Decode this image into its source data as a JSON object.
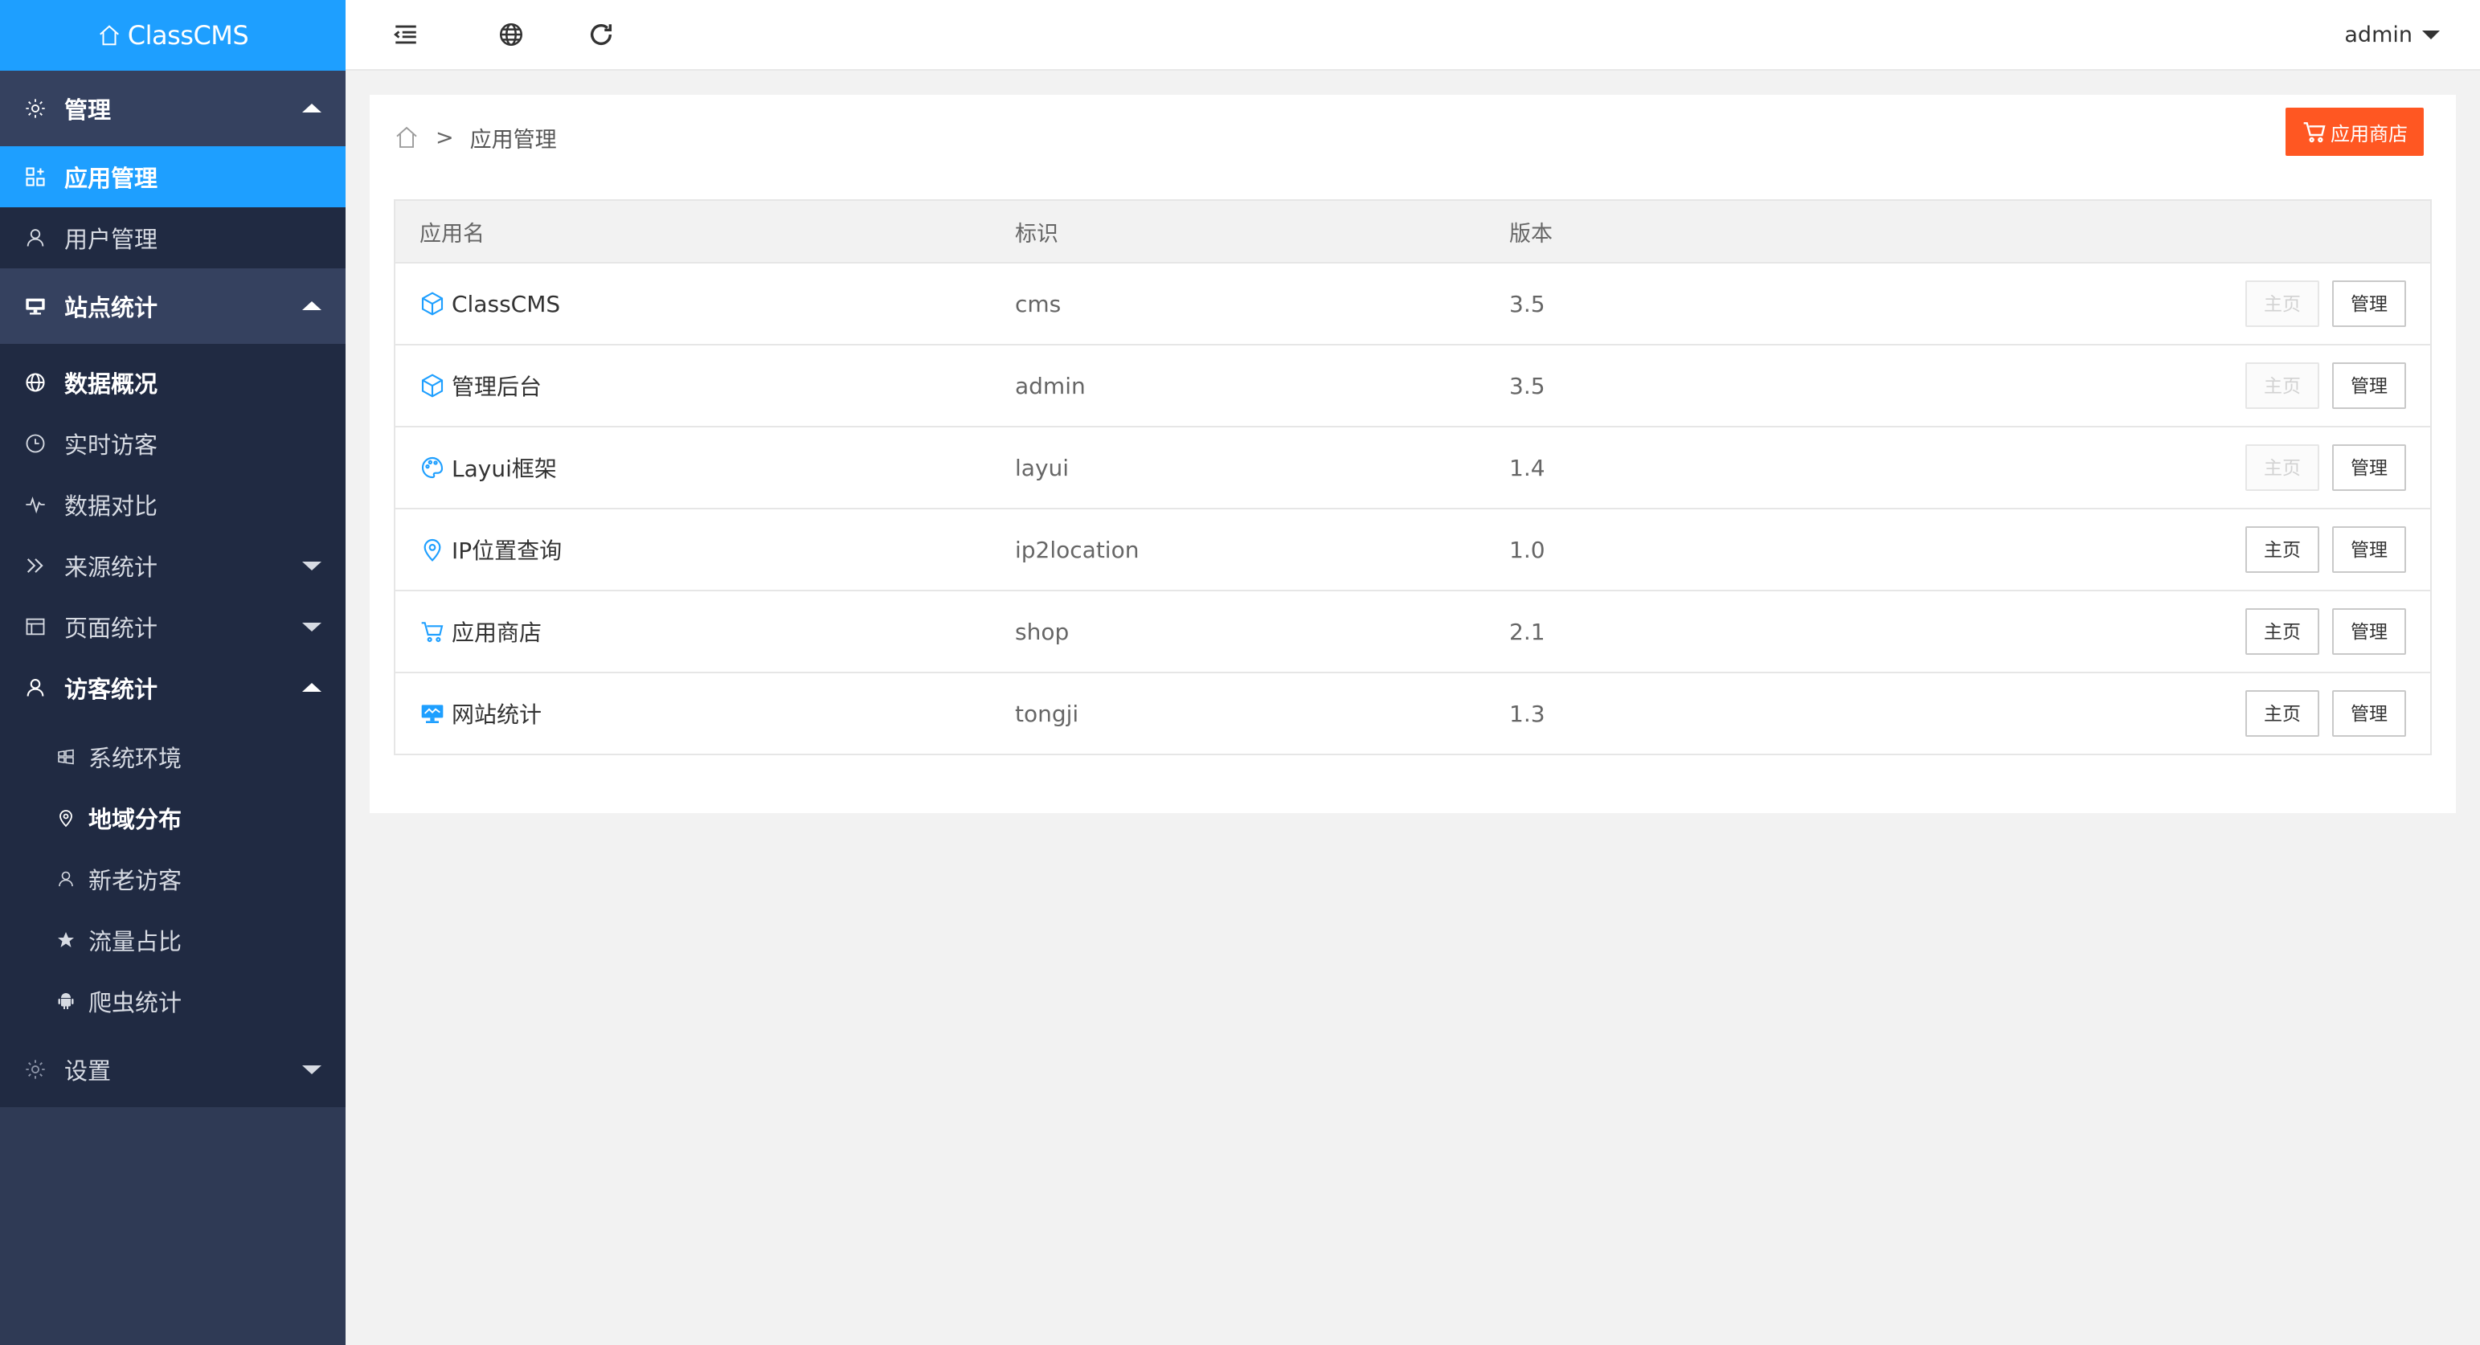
{
  "app": {
    "logo_text": "ClassCMS"
  },
  "sidebar": {
    "groups": [
      {
        "label": "管理",
        "items": [
          {
            "label": "应用管理",
            "active": true
          },
          {
            "label": "用户管理"
          }
        ]
      },
      {
        "label": "站点统计",
        "items": [
          {
            "label": "数据概况"
          },
          {
            "label": "实时访客"
          },
          {
            "label": "数据对比"
          },
          {
            "label": "来源统计"
          },
          {
            "label": "页面统计"
          },
          {
            "label": "访客统计"
          },
          {
            "label": "系统环境"
          },
          {
            "label": "地域分布"
          },
          {
            "label": "新老访客"
          },
          {
            "label": "流量占比"
          },
          {
            "label": "爬虫统计"
          },
          {
            "label": "设置"
          }
        ]
      }
    ]
  },
  "header": {
    "user": "admin"
  },
  "breadcrumb": {
    "current": "应用管理",
    "separator": ">"
  },
  "shop_button": "应用商店",
  "table": {
    "columns": [
      "应用名",
      "标识",
      "版本"
    ],
    "rows": [
      {
        "name": "ClassCMS",
        "id": "cms",
        "version": "3.5",
        "home_enabled": false
      },
      {
        "name": "管理后台",
        "id": "admin",
        "version": "3.5",
        "home_enabled": false
      },
      {
        "name": "Layui框架",
        "id": "layui",
        "version": "1.4",
        "home_enabled": false
      },
      {
        "name": "IP位置查询",
        "id": "ip2location",
        "version": "1.0",
        "home_enabled": true
      },
      {
        "name": "应用商店",
        "id": "shop",
        "version": "2.1",
        "home_enabled": true
      },
      {
        "name": "网站统计",
        "id": "tongji",
        "version": "1.3",
        "home_enabled": true
      }
    ],
    "home_label": "主页",
    "manage_label": "管理"
  },
  "colors": {
    "accent": "#1e9fff",
    "sidebar": "#2f3a55",
    "shop": "#ff5722"
  }
}
